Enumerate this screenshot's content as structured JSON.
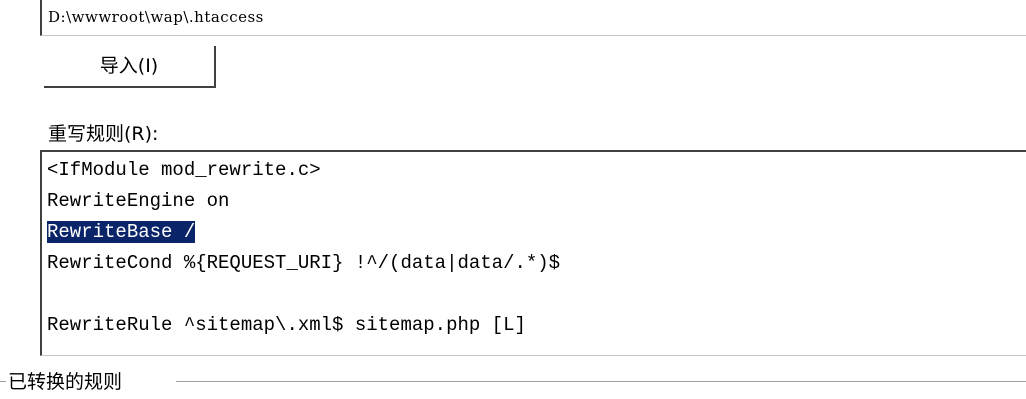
{
  "path_field": {
    "value": "D:\\wwwroot\\wap\\.htaccess"
  },
  "import_button": {
    "label": "导入(I)"
  },
  "rules_label": "重写规则(R):",
  "rules_editor": {
    "lines": [
      "<IfModule mod_rewrite.c>",
      "RewriteEngine on",
      "RewriteBase /",
      "RewriteCond %{REQUEST_URI} !^/(data|data/.*)$",
      "",
      "RewriteRule ^sitemap\\.xml$ sitemap.php [L]"
    ],
    "selected_line_index": 2,
    "selection_color": "#0a246a"
  },
  "converted_group": {
    "title": "已转换的规则"
  }
}
